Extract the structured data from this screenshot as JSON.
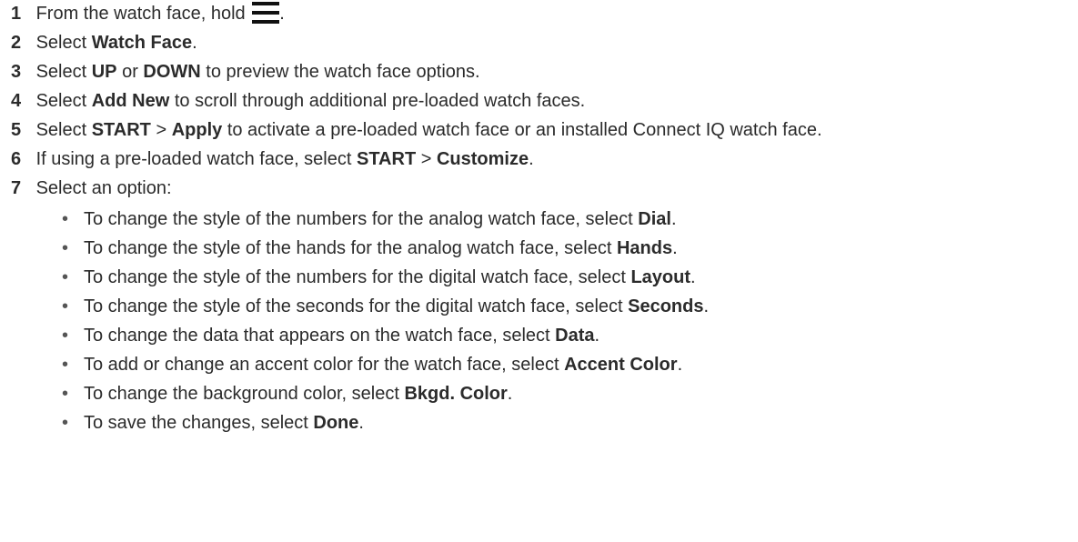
{
  "steps": [
    {
      "num": "1",
      "t1": "From the watch face, hold ",
      "t2": "."
    },
    {
      "num": "2",
      "t1": "Select ",
      "b1": "Watch Face",
      "t2": "."
    },
    {
      "num": "3",
      "t1": "Select ",
      "b1": "UP",
      "t2": " or ",
      "b2": "DOWN",
      "t3": " to preview the watch face options."
    },
    {
      "num": "4",
      "t1": "Select ",
      "b1": "Add New",
      "t2": " to scroll through additional pre-loaded watch faces."
    },
    {
      "num": "5",
      "t1": "Select ",
      "b1": "START",
      "t2": " > ",
      "b2": "Apply",
      "t3": " to activate a pre-loaded watch face or an installed Connect IQ watch face."
    },
    {
      "num": "6",
      "t1": "If using a pre-loaded watch face, select ",
      "b1": "START",
      "t2": " > ",
      "b2": "Customize",
      "t3": "."
    },
    {
      "num": "7",
      "t1": "Select an option:"
    }
  ],
  "bullet_glyph": "•",
  "options": [
    {
      "t1": "To change the style of the numbers for the analog watch face, select ",
      "b1": "Dial",
      "t2": "."
    },
    {
      "t1": "To change the style of the hands for the analog watch face, select ",
      "b1": "Hands",
      "t2": "."
    },
    {
      "t1": "To change the style of the numbers for the digital watch face, select ",
      "b1": "Layout",
      "t2": "."
    },
    {
      "t1": "To change the style of the seconds for the digital watch face, select ",
      "b1": "Seconds",
      "t2": "."
    },
    {
      "t1": "To change the data that appears on the watch face, select ",
      "b1": "Data",
      "t2": "."
    },
    {
      "t1": "To add or change an accent color for the watch face, select ",
      "b1": "Accent Color",
      "t2": "."
    },
    {
      "t1": "To change the background color, select ",
      "b1": "Bkgd. Color",
      "t2": "."
    },
    {
      "t1": "To save the changes, select ",
      "b1": "Done",
      "t2": "."
    }
  ],
  "icons": {
    "menu": "menu-icon"
  }
}
